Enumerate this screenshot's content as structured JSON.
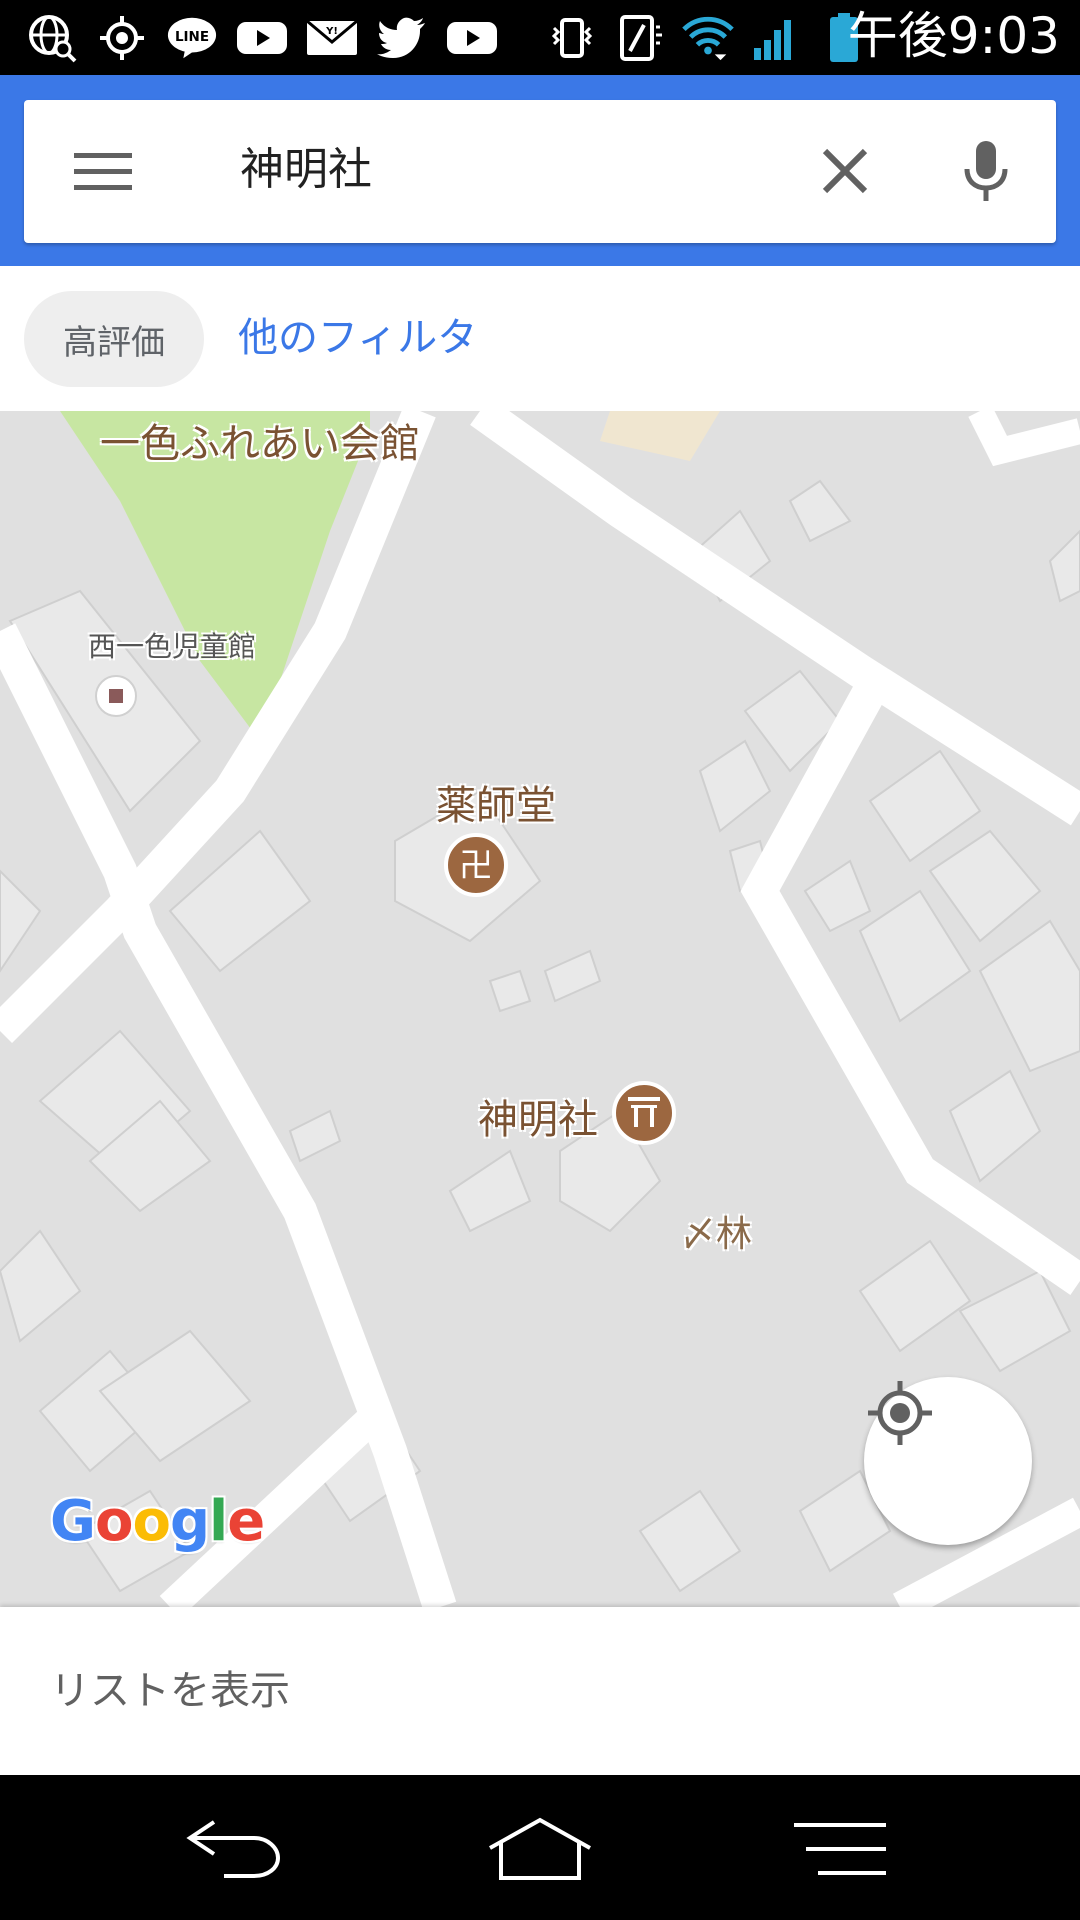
{
  "status_bar": {
    "time": "午後9:03",
    "left_icons": [
      "globe-search-icon",
      "location-target-icon",
      "line-app-icon",
      "youtube-icon",
      "yahoo-mail-icon",
      "twitter-icon",
      "youtube-icon"
    ],
    "right_icons": [
      "vibrate-icon",
      "nfc-icon",
      "wifi-icon",
      "signal-icon",
      "battery-icon"
    ],
    "line_label": "LINE"
  },
  "search": {
    "query": "神明社",
    "menu_icon": "hamburger-icon",
    "clear_icon": "close-icon",
    "mic_icon": "mic-icon",
    "accent": "#3b78e7"
  },
  "filters": {
    "chip_label": "高評価",
    "more_label": "他のフィルタ"
  },
  "map": {
    "labels": {
      "hall": "一色ふれあい会館",
      "children_center": "西一色児童館",
      "temple": "薬師堂",
      "shrine": "神明社",
      "forest": "林"
    },
    "google_logo": "Google"
  },
  "bottom_sheet": {
    "label": "リストを表示"
  },
  "nav_bar": {
    "icons": [
      "back-icon",
      "home-icon",
      "menu-icon"
    ]
  }
}
